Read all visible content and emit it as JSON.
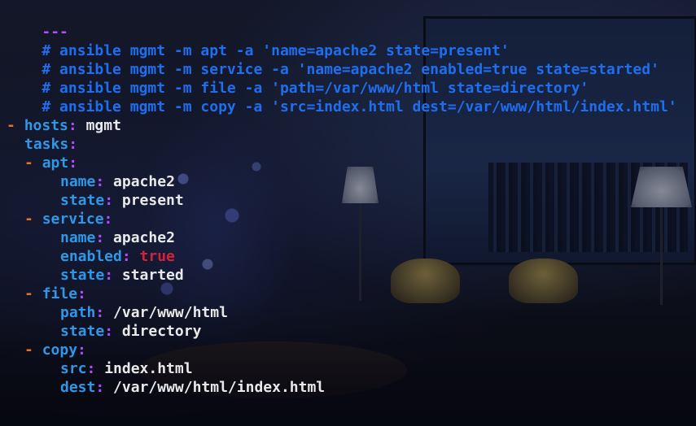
{
  "terminal": {
    "doc_start": "---",
    "comments": [
      "# ansible mgmt -m apt -a 'name=apache2 state=present'",
      "# ansible mgmt -m service -a 'name=apache2 enabled=true state=started'",
      "# ansible mgmt -m file -a 'path=/var/www/html state=directory'",
      "# ansible mgmt -m copy -a 'src=index.html dest=/var/www/html/index.html'"
    ],
    "play": {
      "dash": "-",
      "hosts_key": "hosts",
      "hosts_value": "mgmt",
      "tasks_key": "tasks",
      "colon": ":"
    },
    "tasks": [
      {
        "dash": "-",
        "module": "apt",
        "params": [
          {
            "key": "name",
            "value": "apache2"
          },
          {
            "key": "state",
            "value": "present"
          }
        ]
      },
      {
        "dash": "-",
        "module": "service",
        "params": [
          {
            "key": "name",
            "value": "apache2"
          },
          {
            "key": "enabled",
            "value": "true"
          },
          {
            "key": "state",
            "value": "started"
          }
        ]
      },
      {
        "dash": "-",
        "module": "file",
        "params": [
          {
            "key": "path",
            "value": "/var/www/html"
          },
          {
            "key": "state",
            "value": "directory"
          }
        ]
      },
      {
        "dash": "-",
        "module": "copy",
        "params": [
          {
            "key": "src",
            "value": "index.html"
          },
          {
            "key": "dest",
            "value": "/var/www/html/index.html"
          }
        ]
      }
    ],
    "doc_end": "..."
  },
  "colors": {
    "comment": "#1e6ef0",
    "key": "#2f97e6",
    "punctuation": "#b24cff",
    "dash": "#e8721f",
    "value": "#e9e9e9",
    "boolean": "#d6213a"
  }
}
